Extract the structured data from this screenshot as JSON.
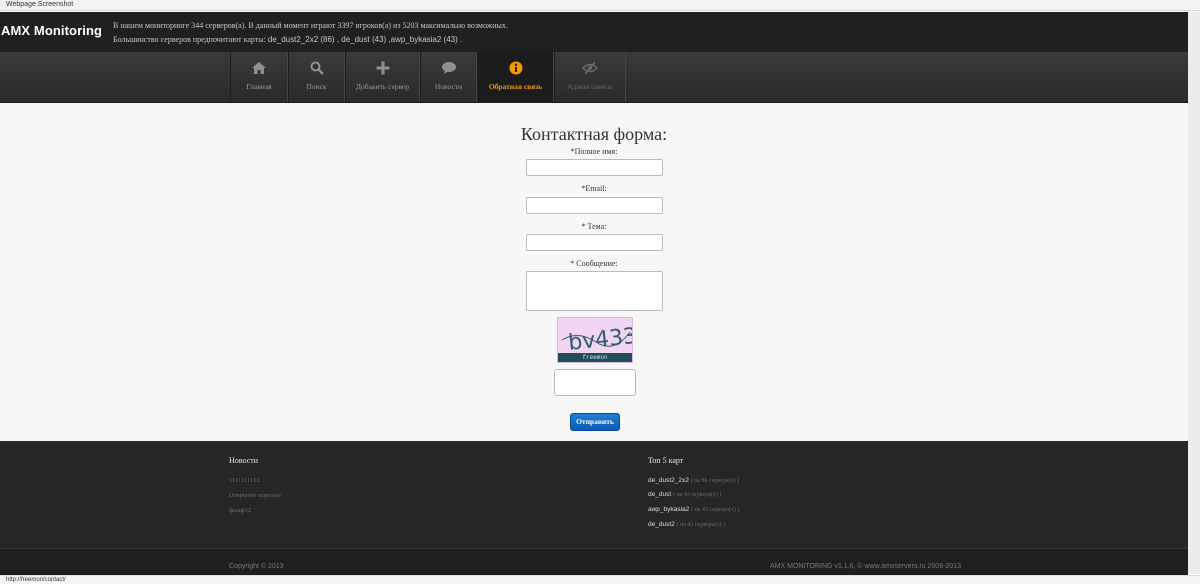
{
  "window": {
    "title": "Webpage Screenshot",
    "status_url": "http://freemon/contact/"
  },
  "header": {
    "brand": "AMX Monitoring",
    "line1": "В нашем мониторинге 344 серверов(а). В данный момент играют 3397 игроков(а) из 5203 максимально возможных.",
    "line2_prefix": "Большинство серверов предпочитают карты: ",
    "line2_maps": "de_dust2_2x2 (86) , de_dust (43) ,awp_bykasia2 (43) ."
  },
  "nav": [
    {
      "label": "Главная",
      "icon": "home-icon"
    },
    {
      "label": "Поиск",
      "icon": "search-icon"
    },
    {
      "label": "Добавить сервер",
      "icon": "plus-icon"
    },
    {
      "label": "Новости",
      "icon": "speech-bubble-icon"
    },
    {
      "label": "Обратная связь",
      "icon": "info-icon",
      "active": true
    },
    {
      "label": "Админ панель",
      "icon": "eye-slash-icon"
    }
  ],
  "form": {
    "title": "Контактная форма:",
    "name_label": "*Полное имя:",
    "email_label": "*Email:",
    "subject_label": "* Тема:",
    "message_label": "* Сообщение:",
    "captcha_text": "bv433",
    "captcha_brand": "freemon",
    "submit_label": "Отправить"
  },
  "footer": {
    "news_title": "Новости",
    "news": [
      "1111111112",
      "Открытие портала!",
      "фыаф12"
    ],
    "maps_title": "Топ 5 карт",
    "maps": [
      {
        "name": "de_dust2_2x2",
        "count": "( на 86 сервера(х) )"
      },
      {
        "name": "de_dust",
        "count": "( на 43 сервера(х) )"
      },
      {
        "name": "awp_bykasia2",
        "count": "( на 43 сервера(х) )"
      },
      {
        "name": "de_dust2",
        "count": "( на 43 сервера(х) )"
      }
    ],
    "copyright": "Copyright © 2013",
    "version": "AMX MONITORING v1.1.6, © www.amxservers.ru 2008-2013"
  },
  "colors": {
    "active_nav": "#f09a00",
    "button": "#0b58b5",
    "header_bg": "#202020"
  }
}
